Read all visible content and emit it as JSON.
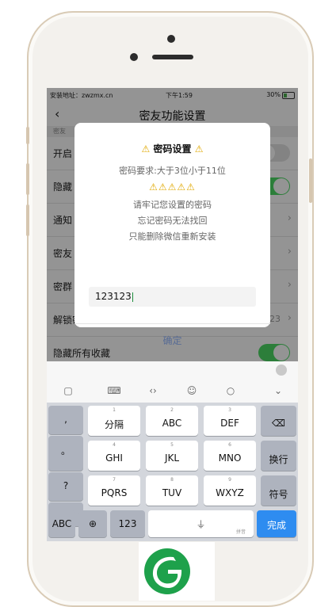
{
  "status_bar": {
    "carrier": "安装地址：zwzmx.cn",
    "time": "下午1:59",
    "battery": "30%"
  },
  "nav": {
    "title": "密友功能设置"
  },
  "settings": {
    "section_head": "密友",
    "rows": [
      {
        "label": "开启"
      },
      {
        "label": "隐藏"
      },
      {
        "label": "通知"
      },
      {
        "label": "密友"
      },
      {
        "label": "密群"
      },
      {
        "label": "解锁密码",
        "value": "123123"
      },
      {
        "label": "隐藏所有收藏"
      }
    ]
  },
  "dialog": {
    "title": "密码设置",
    "requirement": "密码要求:大于3位小于11位",
    "warn_icons": "⚠⚠⚠⚠⚠",
    "line1": "请牢记您设置的密码",
    "line2": "忘记密码无法找回",
    "line3": "只能删除微信重新安装",
    "input_value": "123123",
    "confirm_label": "确定"
  },
  "keyboard": {
    "keys": [
      {
        "num": "1",
        "label": "分隔"
      },
      {
        "num": "2",
        "label": "ABC"
      },
      {
        "num": "3",
        "label": "DEF"
      },
      {
        "num": "4",
        "label": "GHI"
      },
      {
        "num": "5",
        "label": "JKL"
      },
      {
        "num": "6",
        "label": "MNO"
      },
      {
        "num": "7",
        "label": "PQRS"
      },
      {
        "num": "8",
        "label": "TUV"
      },
      {
        "num": "9",
        "label": "WXYZ"
      }
    ],
    "left_col": [
      ",",
      "。",
      "?",
      "..."
    ],
    "switch_label": "换行",
    "symbol_label": "符号",
    "abc_label": "ABC",
    "num_label": "123",
    "done_label": "完成",
    "space_hint": "拼音"
  }
}
